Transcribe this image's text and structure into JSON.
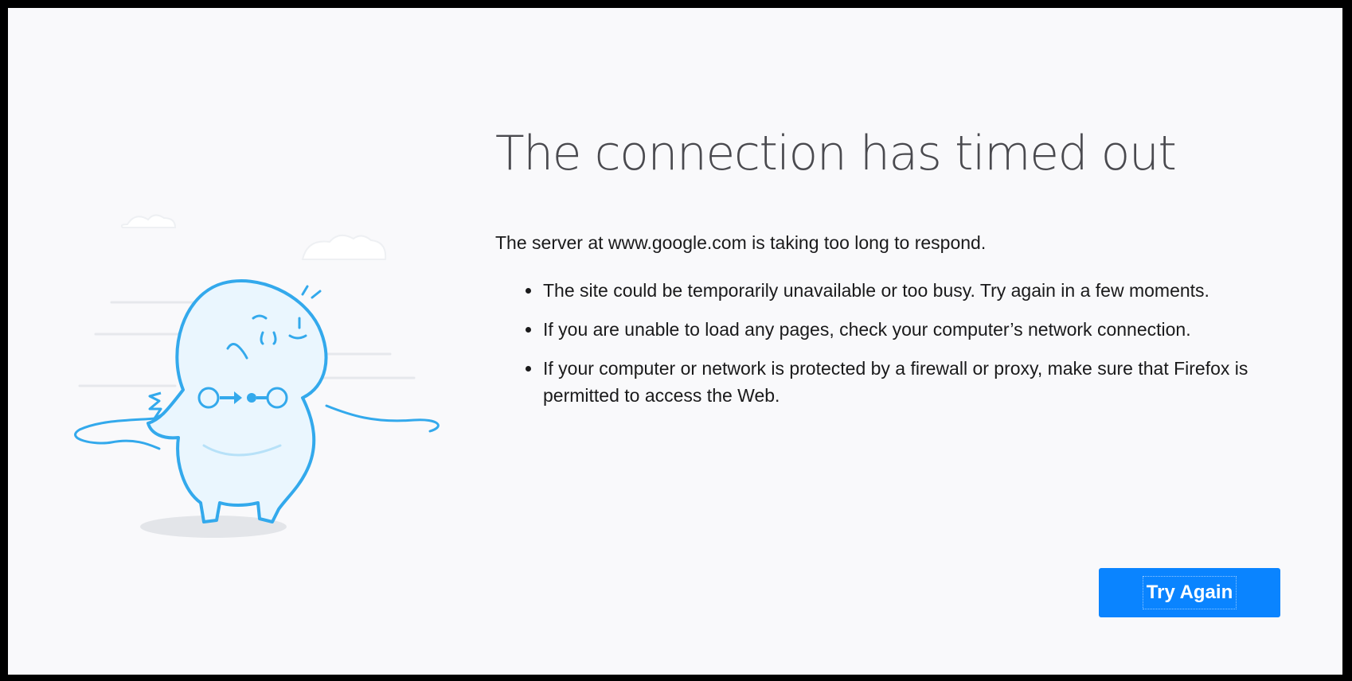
{
  "error_page": {
    "title": "The connection has timed out",
    "description": "The server at www.google.com is taking too long to respond.",
    "suggestions": [
      "The site could be temporarily unavailable or too busy. Try again in a few moments.",
      "If you are unable to load any pages, check your computer’s network connection.",
      "If your computer or network is protected by a firewall or proxy, make sure that Firefox is permitted to access the Web."
    ],
    "try_again_label": "Try Again"
  },
  "illustration": {
    "icon": "unplugged-dino-illustration"
  },
  "colors": {
    "accent": "#0a84ff",
    "page_background": "#f9f9fb",
    "illustration_stroke": "#33a9ec",
    "frame": "#000000"
  }
}
